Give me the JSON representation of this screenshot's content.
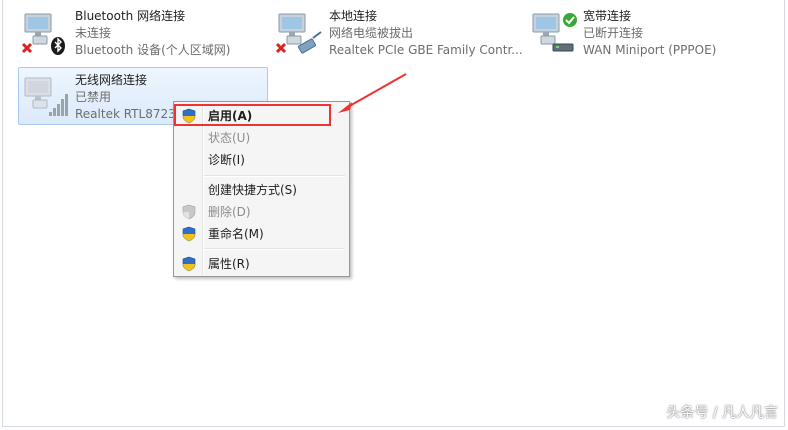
{
  "connections": [
    {
      "name": "Bluetooth 网络连接",
      "status": "未连接",
      "device": "Bluetooth 设备(个人区域网)",
      "icon": "bluetooth-network-icon"
    },
    {
      "name": "本地连接",
      "status": "网络电缆被拔出",
      "device": "Realtek PCIe GBE Family Contr...",
      "icon": "ethernet-network-icon"
    },
    {
      "name": "宽带连接",
      "status": "已断开连接",
      "device": "WAN Miniport (PPPOE)",
      "icon": "broadband-network-icon"
    },
    {
      "name": "无线网络连接",
      "status": "已禁用",
      "device": "Realtek RTL8723",
      "icon": "wireless-network-icon"
    }
  ],
  "context_menu": {
    "enable": "启用(A)",
    "status": "状态(U)",
    "diagnose": "诊断(I)",
    "create_shortcut": "创建快捷方式(S)",
    "delete": "删除(D)",
    "rename": "重命名(M)",
    "properties": "属性(R)"
  },
  "watermark": "头条号 / 凡人凡言",
  "colors": {
    "highlight": "#ee3333",
    "selection": "#dbeafc",
    "disabled_text": "#8d8d8d"
  }
}
